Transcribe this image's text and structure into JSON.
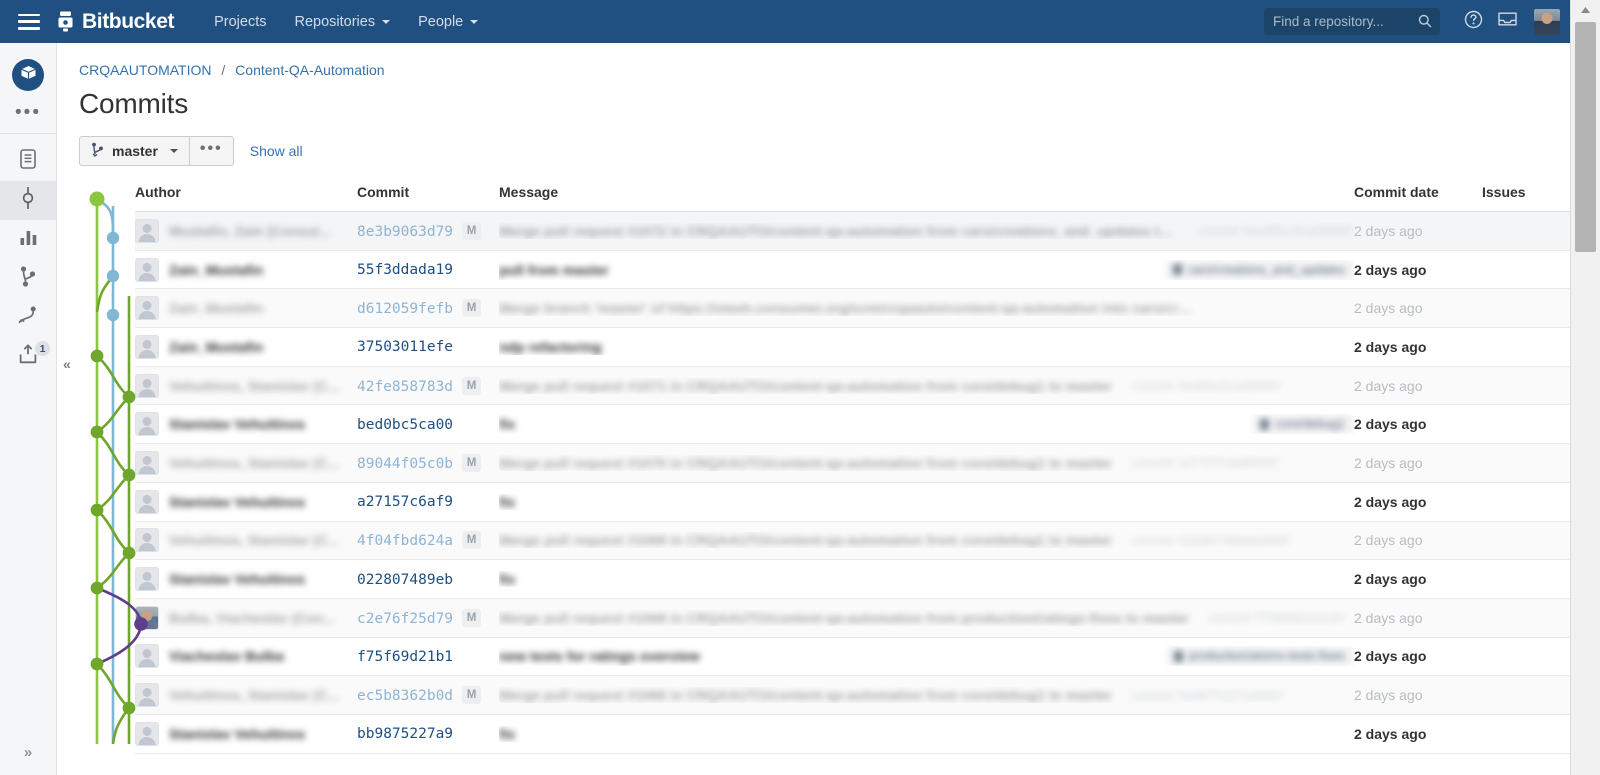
{
  "topnav": {
    "menu_icon": "hamburger-icon",
    "brand": "Bitbucket",
    "items": [
      {
        "label": "Projects",
        "has_caret": false
      },
      {
        "label": "Repositories",
        "has_caret": true
      },
      {
        "label": "People",
        "has_caret": true
      }
    ],
    "search": {
      "placeholder": "Find a repository...",
      "value": ""
    },
    "help_icon": "help-circle-icon",
    "inbox_icon": "inbox-icon",
    "avatar": "user-avatar"
  },
  "sidebar": {
    "repo_avatar_icon": "repository-box-icon",
    "more_label": "•••",
    "items": [
      {
        "icon": "source-file-icon",
        "name": "source",
        "active": false,
        "badge": ""
      },
      {
        "icon": "commits-node-icon",
        "name": "commits",
        "active": true,
        "badge": ""
      },
      {
        "icon": "chart-bar-icon",
        "name": "analytics",
        "active": false,
        "badge": ""
      },
      {
        "icon": "branches-icon",
        "name": "branches",
        "active": false,
        "badge": ""
      },
      {
        "icon": "pull-requests-icon",
        "name": "pull-requests",
        "active": false,
        "badge": ""
      },
      {
        "icon": "deployments-upload-icon",
        "name": "deployments",
        "active": false,
        "badge": "1"
      }
    ],
    "expand_label": "»"
  },
  "breadcrumb": {
    "project": "CRQAAUTOMATION",
    "separator": "/",
    "repo": "Content-QA-Automation"
  },
  "page": {
    "title": "Commits"
  },
  "toolbar": {
    "branch_icon": "branch-icon",
    "branch_label": "master",
    "more_label": "•••",
    "show_all_label": "Show all"
  },
  "table": {
    "headers": {
      "author": "Author",
      "commit": "Commit",
      "message": "Message",
      "date": "Commit date",
      "issues": "Issues"
    },
    "merge_badge": "M",
    "rows": [
      {
        "type": "merge",
        "first": true,
        "avatar": "default",
        "author": "Mustafin, Zain (Consul...",
        "hash": "8e3b9063d79",
        "merge": true,
        "message": "Merge pull request #1072 in CRQAAUTO/content-qa-automation from cars/creations_and_updates to master",
        "meta": "commit 'bea55cc5ca00000'",
        "tag": "",
        "date": "2 days ago"
      },
      {
        "type": "commit",
        "avatar": "default",
        "author": "Zain_Mustafin",
        "hash": "55f3ddada19",
        "merge": false,
        "message": "pull from master",
        "meta": "",
        "tag": "cars/creations_and_updates",
        "date": "2 days ago"
      },
      {
        "type": "merge",
        "avatar": "default",
        "author": "Zain_Mustafin",
        "hash": "d612059fefb",
        "merge": true,
        "message": "Merge branch 'master' of https://stash.consumer.org/scm/crqaauto/content-qa-automation into cars/creations_and_updates",
        "meta": "",
        "tag": "",
        "date": "2 days ago"
      },
      {
        "type": "commit",
        "avatar": "default",
        "author": "Zain_Mustafin",
        "hash": "37503011efe",
        "merge": false,
        "message": "ndp refactoring",
        "meta": "",
        "tag": "",
        "date": "2 days ago"
      },
      {
        "type": "merge",
        "avatar": "default",
        "author": "Vehuitinos, Stanislav (C...",
        "hash": "42fe858783d",
        "merge": true,
        "message": "Merge pull request #1071 in CRQAAUTO/content-qa-automation from core/debug1 to master",
        "meta": "commit 'bed0bc5ca00000'",
        "tag": "",
        "date": "2 days ago"
      },
      {
        "type": "commit",
        "avatar": "default",
        "author": "Stanislav Vehuitinos",
        "hash": "bed0bc5ca00",
        "merge": false,
        "message": "fix",
        "meta": "",
        "tag": "core/debug1",
        "date": "2 days ago"
      },
      {
        "type": "merge",
        "avatar": "default",
        "author": "Vehuitinos, Stanislav (C...",
        "hash": "89044f05c0b",
        "merge": true,
        "message": "Merge pull request #1070 in CRQAAUTO/content-qa-automation from core/debug1 to master",
        "meta": "commit 'a27157c6af9000'",
        "tag": "",
        "date": "2 days ago"
      },
      {
        "type": "commit",
        "avatar": "default",
        "author": "Stanislav Vehuitinos",
        "hash": "a27157c6af9",
        "merge": false,
        "message": "fix",
        "meta": "",
        "tag": "",
        "date": "2 days ago"
      },
      {
        "type": "merge",
        "avatar": "default",
        "author": "Vehuitinos, Stanislav (C...",
        "hash": "4f04fbd624a",
        "merge": true,
        "message": "Merge pull request #1069 in CRQAAUTO/content-qa-automation from core/debug1 to master",
        "meta": "commit '022807489eb0000'",
        "tag": "",
        "date": "2 days ago"
      },
      {
        "type": "commit",
        "avatar": "default",
        "author": "Stanislav Vehuitinos",
        "hash": "022807489eb",
        "merge": false,
        "message": "fix",
        "meta": "",
        "tag": "",
        "date": "2 days ago"
      },
      {
        "type": "merge",
        "avatar": "photo",
        "author": "Bulba, Viacheslav (Con...",
        "hash": "c2e76f25d79",
        "merge": true,
        "message": "Merge pull request #1068 in CRQAAUTO/content-qa-automation from production/ratings-fixes to master",
        "meta": "commit 'f75f69d21b100'",
        "tag": "",
        "date": "2 days ago"
      },
      {
        "type": "commit",
        "avatar": "default",
        "author": "Viacheslav Bulba",
        "hash": "f75f69d21b1",
        "merge": false,
        "message": "new tests for ratings overview",
        "meta": "",
        "tag": "production/atoms-tests-fixes",
        "date": "2 days ago"
      },
      {
        "type": "merge",
        "avatar": "default",
        "author": "Vehuitinos, Stanislav (C...",
        "hash": "ec5b8362b0d",
        "merge": true,
        "message": "Merge pull request #1066 in CRQAAUTO/content-qa-automation from core/debug1 to master",
        "meta": "commit 'bb9875227a9000'",
        "tag": "",
        "date": "2 days ago"
      },
      {
        "type": "commit",
        "avatar": "default",
        "author": "Stanislav Vehuitinos",
        "hash": "bb9875227a9",
        "merge": false,
        "message": "fix",
        "meta": "",
        "tag": "",
        "date": "2 days ago"
      }
    ]
  },
  "graph": {
    "collapse_label": "«",
    "colors": {
      "green": "#8cc63e",
      "green_dark": "#6fa62c",
      "blue": "#7fb7d4",
      "purple": "#5f3c8c"
    }
  },
  "scrollbar": {
    "up_arrow_icon": "scroll-up-arrow-icon"
  }
}
